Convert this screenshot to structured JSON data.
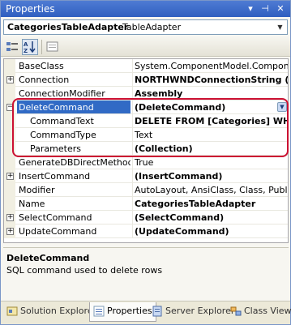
{
  "window": {
    "title": "Properties"
  },
  "titlebar_buttons": {
    "pin": "▾",
    "autohide": "⊣",
    "close": "✕"
  },
  "object_selector": {
    "name": "CategoriesTableAdapter",
    "type": "TableAdapter"
  },
  "grid": {
    "rows": [
      {
        "name": "BaseClass",
        "value": "System.ComponentModel.Component",
        "bold": false,
        "expander": "",
        "child": false,
        "selected": false
      },
      {
        "name": "Connection",
        "value": "NORTHWNDConnectionString (Web.",
        "bold": true,
        "expander": "+",
        "child": false,
        "selected": false
      },
      {
        "name": "ConnectionModifier",
        "value": "Assembly",
        "bold": true,
        "expander": "",
        "child": false,
        "selected": false
      },
      {
        "name": "DeleteCommand",
        "value": "(DeleteCommand)",
        "bold": true,
        "expander": "−",
        "child": false,
        "selected": true
      },
      {
        "name": "CommandText",
        "value": "DELETE FROM [Categories] WHERE",
        "bold": true,
        "expander": "",
        "child": true,
        "selected": false
      },
      {
        "name": "CommandType",
        "value": "Text",
        "bold": false,
        "expander": "",
        "child": true,
        "selected": false
      },
      {
        "name": "Parameters",
        "value": "(Collection)",
        "bold": true,
        "expander": "",
        "child": true,
        "selected": false
      },
      {
        "name": "GenerateDBDirectMethods",
        "value": "True",
        "bold": false,
        "expander": "",
        "child": false,
        "selected": false
      },
      {
        "name": "InsertCommand",
        "value": "(InsertCommand)",
        "bold": true,
        "expander": "+",
        "child": false,
        "selected": false
      },
      {
        "name": "Modifier",
        "value": "AutoLayout, AnsiClass, Class, Public",
        "bold": false,
        "expander": "",
        "child": false,
        "selected": false
      },
      {
        "name": "Name",
        "value": "CategoriesTableAdapter",
        "bold": true,
        "expander": "",
        "child": false,
        "selected": false
      },
      {
        "name": "SelectCommand",
        "value": "(SelectCommand)",
        "bold": true,
        "expander": "+",
        "child": false,
        "selected": false
      },
      {
        "name": "UpdateCommand",
        "value": "(UpdateCommand)",
        "bold": true,
        "expander": "+",
        "child": false,
        "selected": false
      }
    ]
  },
  "description": {
    "title": "DeleteCommand",
    "text": "SQL command used to delete rows"
  },
  "tabs": [
    {
      "label": "Solution Explorer",
      "icon": "solution-explorer-icon"
    },
    {
      "label": "Properties",
      "icon": "properties-icon"
    },
    {
      "label": "Server Explorer",
      "icon": "server-explorer-icon"
    },
    {
      "label": "Class View",
      "icon": "class-view-icon"
    }
  ],
  "colors": {
    "selection": "#316ac5",
    "highlight_annotation": "#cc1133",
    "titlebar": "#2f5fc0"
  }
}
